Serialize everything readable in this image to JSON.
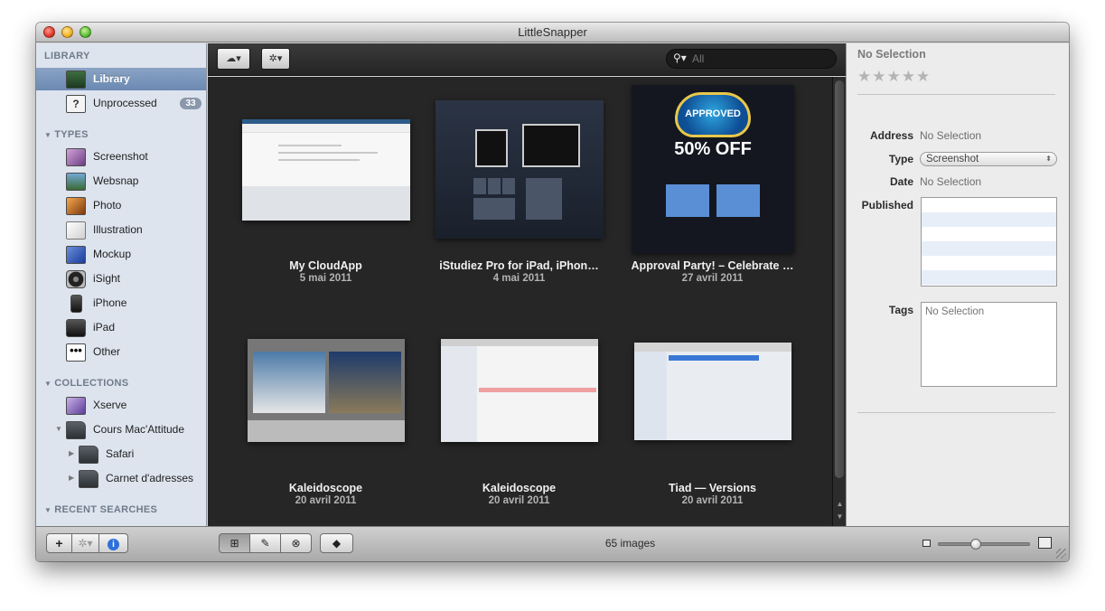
{
  "window": {
    "title": "LittleSnapper"
  },
  "sidebar": {
    "library_header": "LIBRARY",
    "library": [
      {
        "label": "Library",
        "icon": "library-icon"
      },
      {
        "label": "Unprocessed",
        "icon": "unprocessed-icon",
        "badge": "33"
      }
    ],
    "types_header": "TYPES",
    "types": [
      {
        "label": "Screenshot",
        "icon": "screenshot-icon"
      },
      {
        "label": "Websnap",
        "icon": "websnap-icon"
      },
      {
        "label": "Photo",
        "icon": "photo-icon"
      },
      {
        "label": "Illustration",
        "icon": "illustration-icon"
      },
      {
        "label": "Mockup",
        "icon": "mockup-icon"
      },
      {
        "label": "iSight",
        "icon": "isight-icon"
      },
      {
        "label": "iPhone",
        "icon": "iphone-icon"
      },
      {
        "label": "iPad",
        "icon": "ipad-icon"
      },
      {
        "label": "Other",
        "icon": "other-icon"
      }
    ],
    "collections_header": "COLLECTIONS",
    "collections": [
      {
        "label": "Xserve",
        "icon": "xserve-icon"
      },
      {
        "label": "Cours Mac'Attitude",
        "icon": "folder-icon"
      },
      {
        "label": "Safari",
        "icon": "folder-icon"
      },
      {
        "label": "Carnet d'adresses",
        "icon": "folder-icon"
      }
    ],
    "recent_header": "RECENT SEARCHES"
  },
  "toolbar": {
    "cloud_icon": "cloud-icon",
    "gear_icon": "gear-icon",
    "search_placeholder": "All"
  },
  "grid": {
    "items": [
      {
        "title": "My CloudApp",
        "date": "5 mai 2011"
      },
      {
        "title": "iStudiez Pro for iPad, iPhon…",
        "date": "4 mai 2011"
      },
      {
        "title": "Approval Party! – Celebrate …",
        "date": "27 avril 2011"
      },
      {
        "title": "Kaleidoscope",
        "date": "20 avril 2011"
      },
      {
        "title": "Kaleidoscope",
        "date": "20 avril 2011"
      },
      {
        "title": "Tiad — Versions",
        "date": "20 avril 2011"
      }
    ],
    "thumb_texts": {
      "approved": "APPROVED",
      "offer": "50% OFF"
    }
  },
  "inspector": {
    "title": "No Selection",
    "rating_stars": 0,
    "address_label": "Address",
    "address_value": "No Selection",
    "type_label": "Type",
    "type_value": "Screenshot",
    "date_label": "Date",
    "date_value": "No Selection",
    "published_label": "Published",
    "tags_label": "Tags",
    "tags_value": "No Selection"
  },
  "bottombar": {
    "add_label": "+",
    "gear_label": "✲▾",
    "info_label": "i",
    "image_count": "65 images",
    "zoom_level": 0.4
  }
}
